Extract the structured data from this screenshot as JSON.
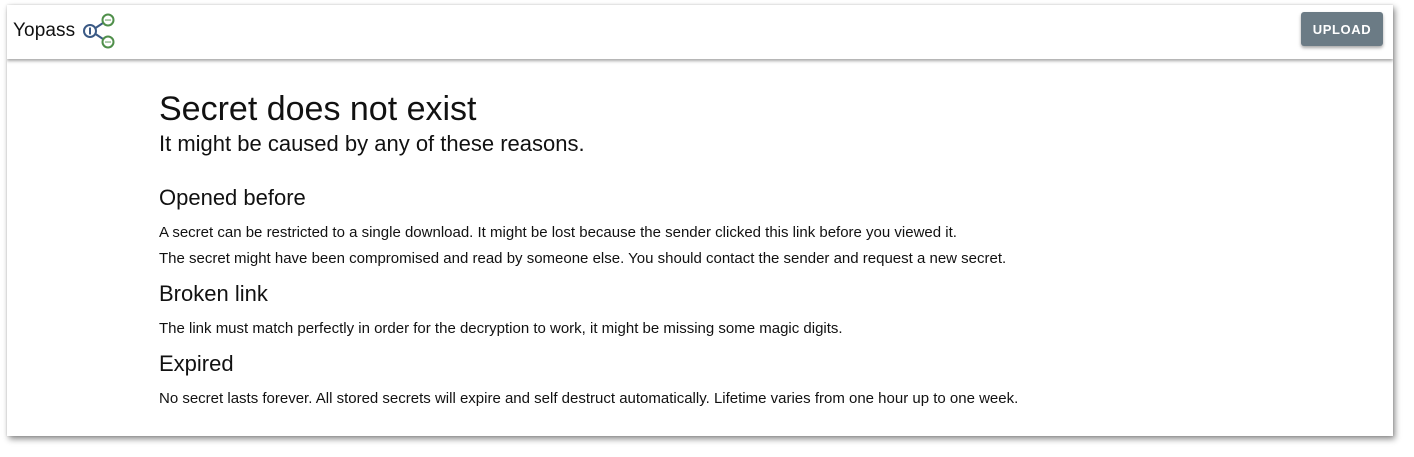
{
  "header": {
    "brand": "Yopass",
    "logo_icon": "share-nodes-icon",
    "upload_label": "UPLOAD"
  },
  "main": {
    "title": "Secret does not exist",
    "subtitle": "It might be caused by any of these reasons.",
    "sections": [
      {
        "heading": "Opened before",
        "paragraphs": [
          "A secret can be restricted to a single download. It might be lost because the sender clicked this link before you viewed it.",
          "The secret might have been compromised and read by someone else. You should contact the sender and request a new secret."
        ]
      },
      {
        "heading": "Broken link",
        "paragraphs": [
          "The link must match perfectly in order for the decryption to work, it might be missing some magic digits."
        ]
      },
      {
        "heading": "Expired",
        "paragraphs": [
          "No secret lasts forever. All stored secrets will expire and self destruct automatically. Lifetime varies from one hour up to one week."
        ]
      }
    ]
  },
  "colors": {
    "upload_button": "#6b7b85",
    "logo_blue": "#3b5a85",
    "logo_green": "#4f8f4a"
  }
}
